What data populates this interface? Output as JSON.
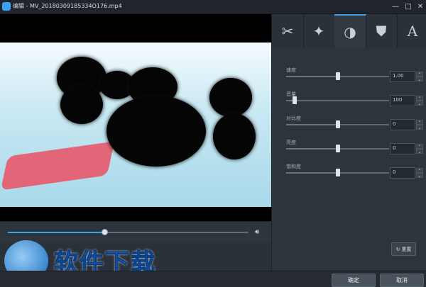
{
  "window": {
    "title": "编辑 - MV_20180309185334O176.mp4",
    "minimize": "—",
    "maximize": "□",
    "close": "✕"
  },
  "player": {
    "progress_fraction": 0.4,
    "volume_icon": "volume-icon"
  },
  "watermark": {
    "text": "软件下载",
    "logo": "dragon-logo"
  },
  "tabs": [
    {
      "name": "cut",
      "icon": "scissors-icon",
      "glyph": "✂"
    },
    {
      "name": "effects",
      "icon": "magic-wand-icon",
      "glyph": "✦"
    },
    {
      "name": "adjust",
      "icon": "brightness-icon",
      "glyph": "◑"
    },
    {
      "name": "watermark",
      "icon": "stamp-icon",
      "glyph": "⛊"
    },
    {
      "name": "text",
      "icon": "text-icon",
      "glyph": "A"
    }
  ],
  "adjust": {
    "rows": [
      {
        "label": "速度",
        "value": "1.00",
        "level": 0.5
      },
      {
        "label": "音量",
        "value": "100",
        "level": 0.08
      },
      {
        "label": "对比度",
        "value": "0",
        "level": 0.5
      },
      {
        "label": "亮度",
        "value": "0",
        "level": 0.5
      },
      {
        "label": "饱和度",
        "value": "0",
        "level": 0.5
      }
    ],
    "reset_label": "重置"
  },
  "footer": {
    "ok_label": "确定",
    "cancel_label": "取消"
  }
}
